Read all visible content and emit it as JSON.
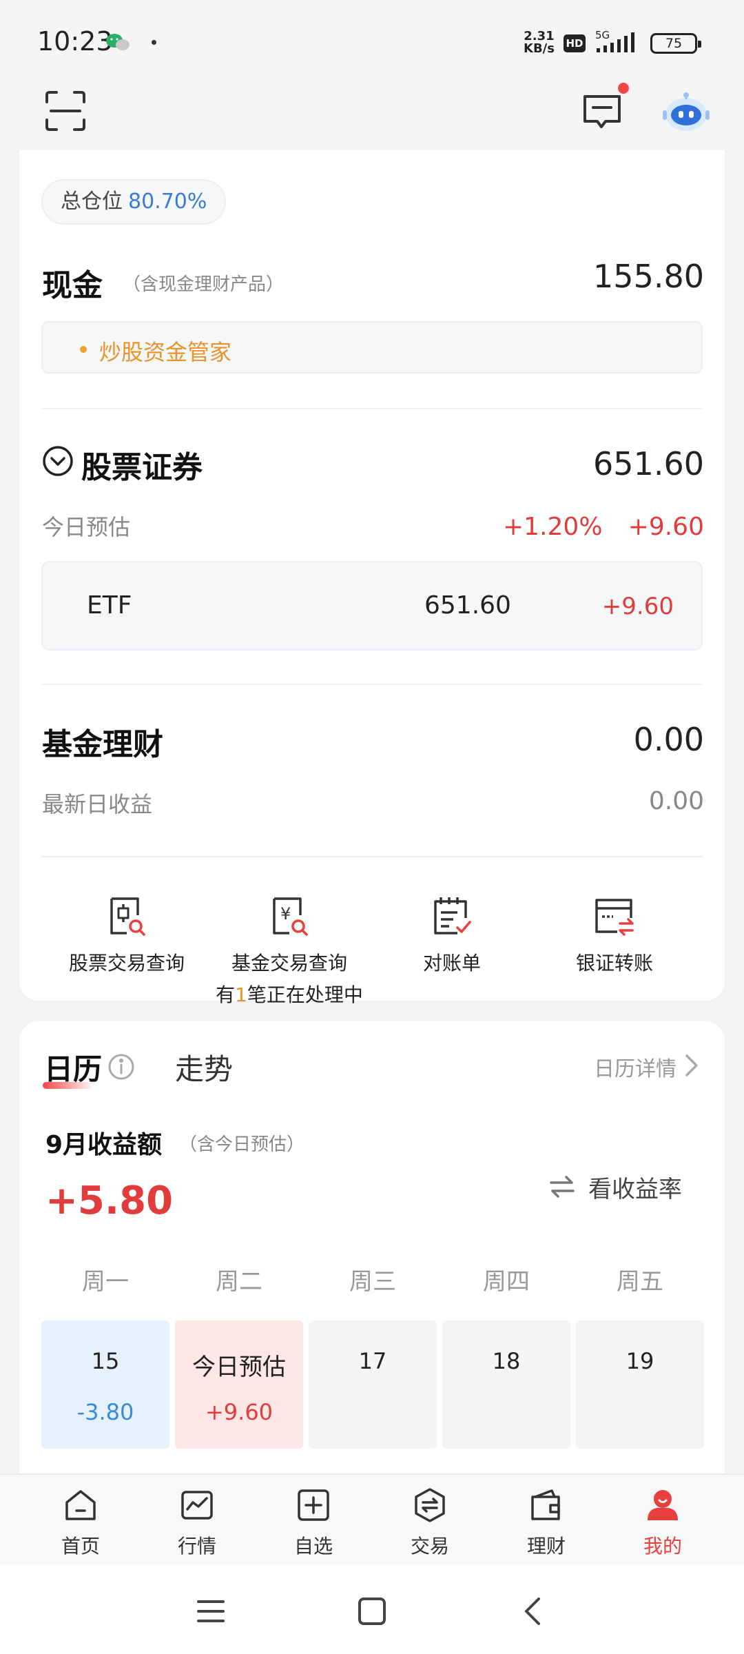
{
  "status_bar": {
    "time": "10:23",
    "net_speed_value": "2.31",
    "net_speed_unit": "KB/s",
    "hd": "HD",
    "network": "5G",
    "battery": "75"
  },
  "summary": {
    "position_label": "总仓位",
    "position_value": "80.70%"
  },
  "cash": {
    "title": "现金",
    "note": "（含现金理财产品）",
    "value": "155.80",
    "manager_label": "炒股资金管家"
  },
  "stocks": {
    "title": "股票证券",
    "value": "651.60",
    "today_label": "今日预估",
    "today_pct": "+1.20%",
    "today_amount": "+9.60",
    "etf": {
      "name": "ETF",
      "value": "651.60",
      "change": "+9.60"
    }
  },
  "funds": {
    "title": "基金理财",
    "value": "0.00",
    "daily_label": "最新日收益",
    "daily_value": "0.00"
  },
  "quick_actions": [
    {
      "label": "股票交易查询",
      "icon": "stock-query-icon"
    },
    {
      "label": "基金交易查询",
      "icon": "fund-query-icon",
      "sub_prefix": "有",
      "sub_count": "1",
      "sub_suffix": "笔正在处理中"
    },
    {
      "label": "对账单",
      "icon": "statement-icon"
    },
    {
      "label": "银证转账",
      "icon": "bank-transfer-icon"
    }
  ],
  "calendar": {
    "tab_calendar": "日历",
    "tab_trend": "走势",
    "detail_link": "日历详情",
    "month_title": "9月收益额",
    "month_note": "（含今日预估）",
    "month_value": "+5.80",
    "switch_label": "看收益率",
    "weekdays": [
      "周一",
      "周二",
      "周三",
      "周四",
      "周五"
    ],
    "days": [
      {
        "day": "15",
        "value": "-3.80"
      },
      {
        "day": "今日预估",
        "value": "+9.60"
      },
      {
        "day": "17",
        "value": ""
      },
      {
        "day": "18",
        "value": ""
      },
      {
        "day": "19",
        "value": ""
      }
    ],
    "colors": {
      "loss": "#3a8ad6",
      "gain": "#e03c3c",
      "loss_bg": "#e5f1fd",
      "gain_bg": "#fde6e6"
    }
  },
  "bottom_nav": [
    {
      "label": "首页",
      "icon": "home-icon"
    },
    {
      "label": "行情",
      "icon": "market-icon"
    },
    {
      "label": "自选",
      "icon": "watchlist-add-icon"
    },
    {
      "label": "交易",
      "icon": "trade-icon"
    },
    {
      "label": "理财",
      "icon": "wallet-icon"
    },
    {
      "label": "我的",
      "icon": "profile-icon",
      "active": true
    }
  ],
  "theme": {
    "accent_red": "#e8403e",
    "accent_orange": "#e8922a",
    "accent_blue": "#3a7bd5"
  }
}
